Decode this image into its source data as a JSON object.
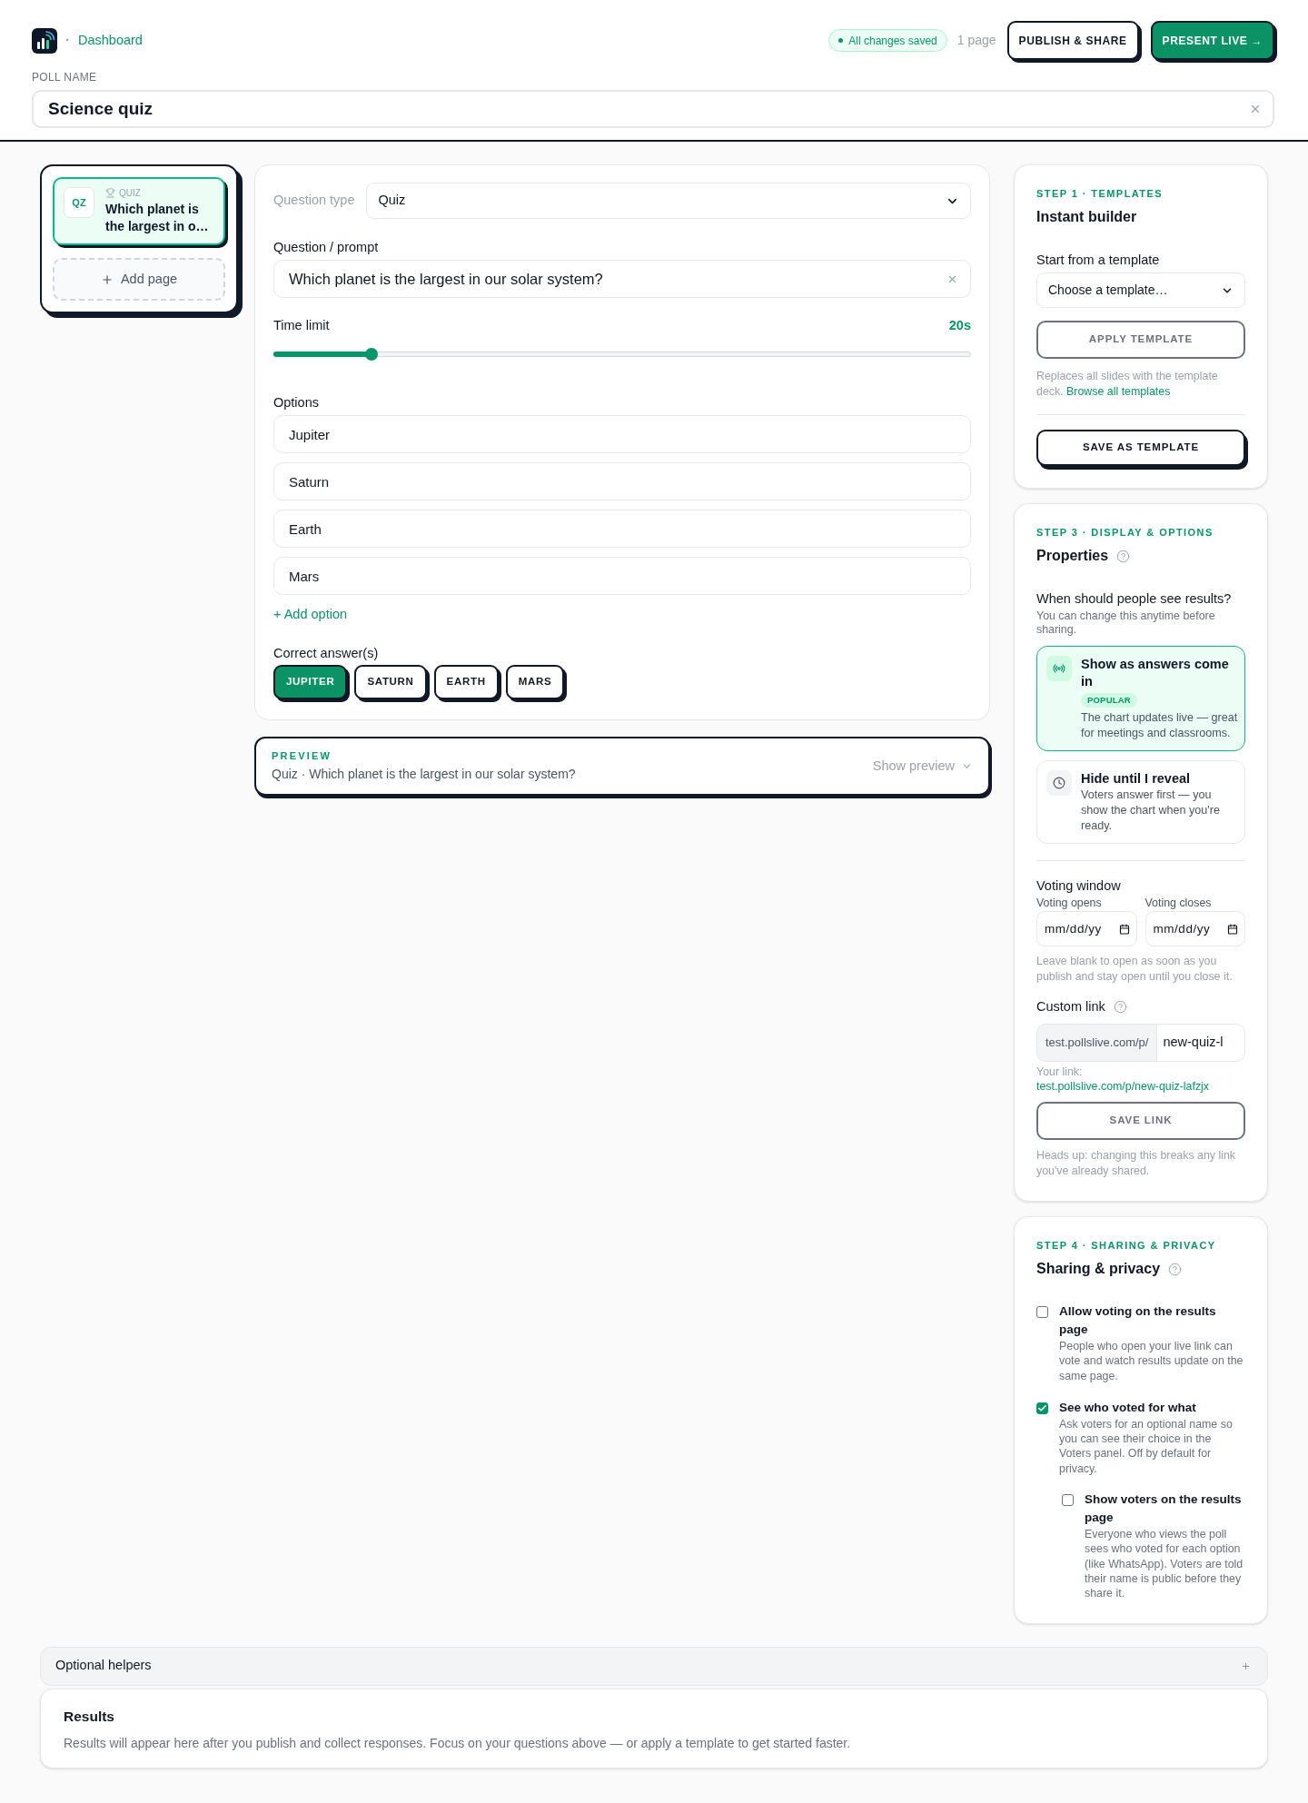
{
  "header": {
    "breadcrumb": {
      "separator": "·",
      "label": "Dashboard"
    },
    "save_status": "All changes saved",
    "page_count": "1 page",
    "buttons": [
      {
        "label": "PUBLISH & SHARE",
        "kind": "outline"
      },
      {
        "label": "PRESENT LIVE →",
        "kind": "primary"
      }
    ]
  },
  "poll_name": {
    "label": "POLL NAME",
    "value": "Science quiz"
  },
  "pages": {
    "items": [
      {
        "badge": "QZ",
        "type": "QUIZ",
        "title": "Which planet is the largest in o…",
        "selected": true
      }
    ],
    "add_button": "Add page"
  },
  "editor": {
    "question_type": {
      "label": "Question type",
      "value": "Quiz"
    },
    "prompt": {
      "label": "Question / prompt",
      "value": "Which planet is the largest in our solar system?"
    },
    "time_limit": {
      "label": "Time limit",
      "reading": "20s",
      "level": 0.14
    },
    "options": {
      "label": "Options",
      "items": [
        "Jupiter",
        "Saturn",
        "Earth",
        "Mars"
      ],
      "add_link": "+ Add option"
    },
    "correct_answers": {
      "label": "Correct answer(s)",
      "items": [
        {
          "label": "JUPITER",
          "selected": true
        },
        {
          "label": "SATURN",
          "selected": false
        },
        {
          "label": "EARTH",
          "selected": false
        },
        {
          "label": "MARS",
          "selected": false
        }
      ]
    }
  },
  "preview": {
    "label": "PREVIEW",
    "summary": "Quiz · Which planet is the largest in our solar system?",
    "toggle": "Show preview"
  },
  "templates": {
    "step": "STEP 1 · TEMPLATES",
    "title": "Instant builder",
    "select": {
      "label": "Start from a template",
      "value": "Choose a template…"
    },
    "apply_button": {
      "label": "APPLY TEMPLATE",
      "disabled": true
    },
    "note": "Replaces all slides with the template deck.",
    "note_link": "Browse all templates",
    "save_button": "SAVE AS TEMPLATE"
  },
  "display": {
    "step": "STEP 3 · DISPLAY & OPTIONS",
    "title": "Properties",
    "question": "When should people see results?",
    "hint": "You can change this anytime before sharing.",
    "modes": [
      {
        "kind": "live",
        "title": "Show as answers come in",
        "badge": "POPULAR",
        "description": "The chart updates live — great for meetings and classrooms.",
        "selected": true
      },
      {
        "kind": "manual",
        "title": "Hide until I reveal",
        "description": "Voters answer first — you show the chart when you're ready.",
        "selected": false
      }
    ],
    "voting_window": {
      "title": "Voting window",
      "fields": [
        {
          "label": "Voting opens",
          "placeholder": "mm/dd/yy"
        },
        {
          "label": "Voting closes",
          "placeholder": "mm/dd/yy"
        }
      ],
      "note": "Leave blank to open as soon as you publish and stay open until you close it."
    },
    "custom_link": {
      "title": "Custom link",
      "prefix": "test.pollslive.com/p/",
      "value": "new-quiz-l",
      "your_link_label": "Your link:",
      "your_link": "test.pollslive.com/p/new-quiz-lafzjx",
      "save_button": {
        "label": "SAVE LINK",
        "disabled": true
      },
      "note": "Heads up: changing this breaks any link you've already shared."
    }
  },
  "sharing": {
    "step": "STEP 4 · SHARING & PRIVACY",
    "title": "Sharing & privacy",
    "options": [
      {
        "title": "Allow voting on the results page",
        "description": "People who open your live link can vote and watch results update on the same page.",
        "checked": false
      },
      {
        "title": "See who voted for what",
        "description": "Ask voters for an optional name so you can see their choice in the Voters panel. Off by default for privacy.",
        "checked": true,
        "children": [
          {
            "title": "Show voters on the results page",
            "description": "Everyone who views the poll sees who voted for each option (like WhatsApp). Voters are told their name is public before they share it.",
            "checked": false
          }
        ]
      }
    ]
  },
  "helpers": {
    "title": "Optional helpers"
  },
  "results": {
    "title": "Results",
    "text": "Results will appear here after you publish and collect responses. Focus on your questions above — or apply a template to get started faster."
  }
}
